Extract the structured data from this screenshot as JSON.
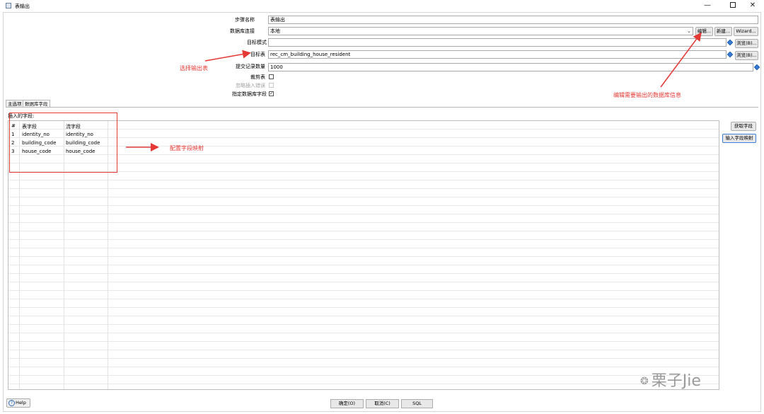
{
  "window": {
    "title": "表输出"
  },
  "form": {
    "step_name_label": "步骤名称",
    "step_name_value": "表输出",
    "connection_label": "数据库连接",
    "connection_value": "本地",
    "edit_button": "编辑...",
    "new_button": "新建...",
    "wizard_button": "Wizard...",
    "schema_label": "目标模式",
    "schema_value": "",
    "browse_button": "浏览(B)...",
    "target_table_label": "目标表",
    "target_table_value": "rec_cm_building_house_resident",
    "commit_size_label": "提交记录数量",
    "commit_size_value": "1000",
    "truncate_label": "裁剪表",
    "truncate_checked": false,
    "ignore_errors_label": "忽略插入错误",
    "ignore_errors_checked": false,
    "specify_fields_label": "指定数据库字段",
    "specify_fields_checked": true
  },
  "tabs": [
    {
      "label": "主选项",
      "active": false
    },
    {
      "label": "数据库字段",
      "active": true
    }
  ],
  "fields_section": {
    "title": "插入的字段:",
    "columns": [
      "#",
      "表字段",
      "流字段"
    ],
    "rows": [
      {
        "num": "1",
        "table_field": "identity_no",
        "stream_field": "identity_no"
      },
      {
        "num": "2",
        "table_field": "building_code",
        "stream_field": "building_code"
      },
      {
        "num": "3",
        "table_field": "house_code",
        "stream_field": "house_code"
      }
    ],
    "get_fields_button": "获取字段",
    "field_mapping_button": "输入字段映射"
  },
  "annotations": {
    "select_table": "选择输出表",
    "edit_db": "编辑需要输出的数据库信息",
    "field_mapping": "配置字段映射",
    "color": "#e53935"
  },
  "footer": {
    "help": "Help",
    "ok": "确定(O)",
    "cancel": "取消(C)",
    "sql": "SQL"
  },
  "watermark": "栗子Jie"
}
